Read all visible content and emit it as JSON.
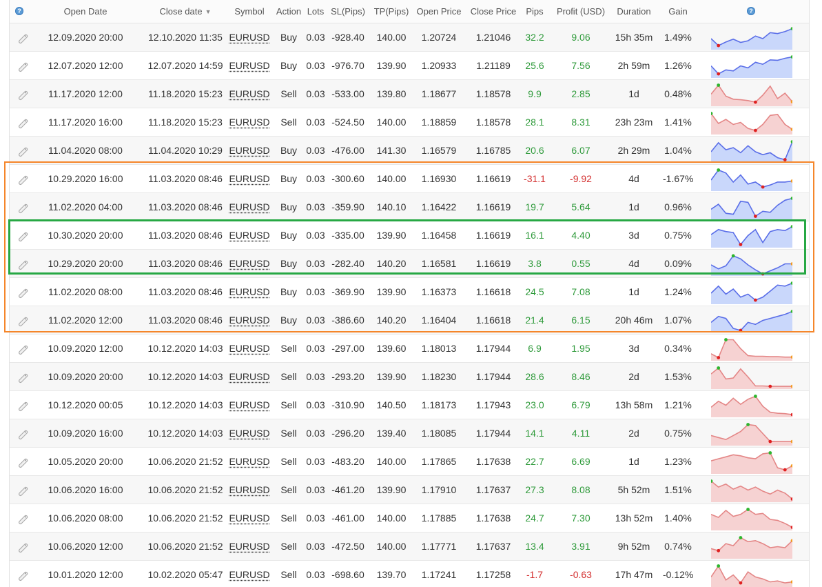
{
  "columns": {
    "open_date": "Open Date",
    "close_date": "Close date",
    "symbol": "Symbol",
    "action": "Action",
    "lots": "Lots",
    "sl": "SL(Pips)",
    "tp": "TP(Pips)",
    "open_price": "Open Price",
    "close_price": "Close Price",
    "pips": "Pips",
    "profit": "Profit (USD)",
    "duration": "Duration",
    "gain": "Gain",
    "help_glyph": "?"
  },
  "colors": {
    "positive": "#2e9a3a",
    "negative": "#d32f2f",
    "buy_line": "#5a6ee8",
    "buy_fill": "#c9d7fb",
    "sell_line": "#e48686",
    "sell_fill": "#f6d2d2",
    "highlight_orange": "#f5862a",
    "highlight_green": "#27a844"
  },
  "trades": [
    {
      "open": "12.09.2020 20:00",
      "close": "12.10.2020 11:35",
      "symbol": "EURUSD",
      "action": "Buy",
      "lots": "0.03",
      "sl": "-928.40",
      "tp": "140.00",
      "open_price": "1.20724",
      "close_price": "1.21046",
      "pips": "32.2",
      "profit": "9.06",
      "duration": "15h 35m",
      "gain": "1.49%",
      "spark": [
        0.55,
        0.9,
        0.72,
        0.58,
        0.74,
        0.66,
        0.42,
        0.55,
        0.25,
        0.3,
        0.2,
        0.05
      ]
    },
    {
      "open": "12.07.2020 12:00",
      "close": "12.07.2020 14:59",
      "symbol": "EURUSD",
      "action": "Buy",
      "lots": "0.03",
      "sl": "-976.70",
      "tp": "139.90",
      "open_price": "1.20933",
      "close_price": "1.21189",
      "pips": "25.6",
      "profit": "7.56",
      "duration": "2h 59m",
      "gain": "1.26%",
      "spark": [
        0.5,
        0.9,
        0.7,
        0.75,
        0.5,
        0.6,
        0.32,
        0.42,
        0.2,
        0.22,
        0.12,
        0.05
      ]
    },
    {
      "open": "11.17.2020 12:00",
      "close": "11.18.2020 15:23",
      "symbol": "EURUSD",
      "action": "Sell",
      "lots": "0.03",
      "sl": "-533.00",
      "tp": "139.80",
      "open_price": "1.18677",
      "close_price": "1.18578",
      "pips": "9.9",
      "profit": "2.85",
      "duration": "1d",
      "gain": "0.48%",
      "spark": [
        0.5,
        0.05,
        0.6,
        0.75,
        0.78,
        0.82,
        0.9,
        0.55,
        0.1,
        0.72,
        0.45,
        0.88
      ]
    },
    {
      "open": "11.17.2020 16:00",
      "close": "11.18.2020 15:23",
      "symbol": "EURUSD",
      "action": "Sell",
      "lots": "0.03",
      "sl": "-524.50",
      "tp": "140.00",
      "open_price": "1.18859",
      "close_price": "1.18578",
      "pips": "28.1",
      "profit": "8.31",
      "duration": "23h 23m",
      "gain": "1.41%",
      "spark": [
        0.05,
        0.55,
        0.35,
        0.6,
        0.5,
        0.8,
        0.9,
        0.6,
        0.15,
        0.1,
        0.6,
        0.85
      ]
    },
    {
      "open": "11.04.2020 08:00",
      "close": "11.04.2020 10:29",
      "symbol": "EURUSD",
      "action": "Buy",
      "lots": "0.03",
      "sl": "-476.00",
      "tp": "141.30",
      "open_price": "1.16579",
      "close_price": "1.16785",
      "pips": "20.6",
      "profit": "6.07",
      "duration": "2h 29m",
      "gain": "1.04%",
      "spark": [
        0.55,
        0.1,
        0.45,
        0.35,
        0.6,
        0.25,
        0.55,
        0.7,
        0.6,
        0.85,
        0.95,
        0.05
      ]
    },
    {
      "open": "10.29.2020 16:00",
      "close": "11.03.2020 08:46",
      "symbol": "EURUSD",
      "action": "Buy",
      "lots": "0.03",
      "sl": "-300.60",
      "tp": "140.00",
      "open_price": "1.16930",
      "close_price": "1.16619",
      "pips": "-31.1",
      "profit": "-9.92",
      "duration": "4d",
      "gain": "-1.67%",
      "spark": [
        0.55,
        0.05,
        0.2,
        0.65,
        0.3,
        0.75,
        0.65,
        0.9,
        0.8,
        0.65,
        0.65,
        0.6
      ]
    },
    {
      "open": "11.02.2020 04:00",
      "close": "11.03.2020 08:46",
      "symbol": "EURUSD",
      "action": "Buy",
      "lots": "0.03",
      "sl": "-359.90",
      "tp": "140.10",
      "open_price": "1.16422",
      "close_price": "1.16619",
      "pips": "19.7",
      "profit": "5.64",
      "duration": "1d",
      "gain": "0.96%",
      "spark": [
        0.6,
        0.35,
        0.8,
        0.85,
        0.2,
        0.25,
        0.95,
        0.7,
        0.75,
        0.4,
        0.15,
        0.05
      ]
    },
    {
      "open": "10.30.2020 20:00",
      "close": "11.03.2020 08:46",
      "symbol": "EURUSD",
      "action": "Buy",
      "lots": "0.03",
      "sl": "-335.00",
      "tp": "139.90",
      "open_price": "1.16458",
      "close_price": "1.16619",
      "pips": "16.1",
      "profit": "4.40",
      "duration": "3d",
      "gain": "0.75%",
      "spark": [
        0.45,
        0.2,
        0.3,
        0.35,
        0.95,
        0.5,
        0.2,
        0.85,
        0.3,
        0.2,
        0.25,
        0.05
      ]
    },
    {
      "open": "10.29.2020 20:00",
      "close": "11.03.2020 08:46",
      "symbol": "EURUSD",
      "action": "Buy",
      "lots": "0.03",
      "sl": "-282.40",
      "tp": "140.20",
      "open_price": "1.16581",
      "close_price": "1.16619",
      "pips": "3.8",
      "profit": "0.55",
      "duration": "4d",
      "gain": "0.09%",
      "spark": [
        0.55,
        0.75,
        0.6,
        0.1,
        0.25,
        0.55,
        0.8,
        1.0,
        0.85,
        0.7,
        0.5,
        0.5
      ]
    },
    {
      "open": "11.02.2020 08:00",
      "close": "11.03.2020 08:46",
      "symbol": "EURUSD",
      "action": "Buy",
      "lots": "0.03",
      "sl": "-369.90",
      "tp": "139.90",
      "open_price": "1.16373",
      "close_price": "1.16618",
      "pips": "24.5",
      "profit": "7.08",
      "duration": "1d",
      "gain": "1.24%",
      "spark": [
        0.55,
        0.2,
        0.6,
        0.35,
        0.75,
        0.6,
        0.9,
        0.75,
        0.45,
        0.15,
        0.2,
        0.05
      ]
    },
    {
      "open": "11.02.2020 12:00",
      "close": "11.03.2020 08:46",
      "symbol": "EURUSD",
      "action": "Buy",
      "lots": "0.03",
      "sl": "-386.60",
      "tp": "140.20",
      "open_price": "1.16404",
      "close_price": "1.16618",
      "pips": "21.4",
      "profit": "6.15",
      "duration": "20h 46m",
      "gain": "1.07%",
      "spark": [
        0.6,
        0.3,
        0.4,
        0.9,
        1.0,
        0.6,
        0.7,
        0.5,
        0.4,
        0.3,
        0.2,
        0.05
      ]
    },
    {
      "open": "10.09.2020 12:00",
      "close": "10.12.2020 14:03",
      "symbol": "EURUSD",
      "action": "Sell",
      "lots": "0.03",
      "sl": "-297.00",
      "tp": "139.60",
      "open_price": "1.18013",
      "close_price": "1.17944",
      "pips": "6.9",
      "profit": "1.95",
      "duration": "3d",
      "gain": "0.34%",
      "spark": [
        0.75,
        0.95,
        0.05,
        0.05,
        0.5,
        0.85,
        0.88,
        0.88,
        0.9,
        0.9,
        0.92,
        0.92
      ]
    },
    {
      "open": "10.09.2020 20:00",
      "close": "10.12.2020 14:03",
      "symbol": "EURUSD",
      "action": "Sell",
      "lots": "0.03",
      "sl": "-293.20",
      "tp": "139.90",
      "open_price": "1.18230",
      "close_price": "1.17944",
      "pips": "28.6",
      "profit": "8.46",
      "duration": "2d",
      "gain": "1.53%",
      "spark": [
        0.35,
        0.05,
        0.6,
        0.55,
        0.1,
        0.5,
        0.95,
        0.95,
        0.97,
        0.97,
        0.97,
        0.97
      ]
    },
    {
      "open": "10.12.2020 00:05",
      "close": "10.12.2020 14:03",
      "symbol": "EURUSD",
      "action": "Sell",
      "lots": "0.03",
      "sl": "-310.90",
      "tp": "140.50",
      "open_price": "1.18173",
      "close_price": "1.17943",
      "pips": "23.0",
      "profit": "6.79",
      "duration": "13h 58m",
      "gain": "1.21%",
      "spark": [
        0.6,
        0.3,
        0.5,
        0.15,
        0.45,
        0.2,
        0.05,
        0.55,
        0.85,
        0.9,
        0.92,
        0.97
      ]
    },
    {
      "open": "10.09.2020 16:00",
      "close": "10.12.2020 14:03",
      "symbol": "EURUSD",
      "action": "Sell",
      "lots": "0.03",
      "sl": "-296.20",
      "tp": "139.40",
      "open_price": "1.18085",
      "close_price": "1.17944",
      "pips": "14.1",
      "profit": "4.11",
      "duration": "2d",
      "gain": "0.75%",
      "spark": [
        0.6,
        0.7,
        0.8,
        0.6,
        0.4,
        0.05,
        0.1,
        0.5,
        0.9,
        0.9,
        0.9,
        0.9
      ]
    },
    {
      "open": "10.05.2020 20:00",
      "close": "10.06.2020 21:52",
      "symbol": "EURUSD",
      "action": "Sell",
      "lots": "0.03",
      "sl": "-483.20",
      "tp": "140.00",
      "open_price": "1.17865",
      "close_price": "1.17638",
      "pips": "22.7",
      "profit": "6.69",
      "duration": "1d",
      "gain": "1.23%",
      "spark": [
        0.45,
        0.35,
        0.25,
        0.15,
        0.2,
        0.3,
        0.35,
        0.1,
        0.05,
        0.8,
        0.9,
        0.7
      ]
    },
    {
      "open": "10.06.2020 16:00",
      "close": "10.06.2020 21:52",
      "symbol": "EURUSD",
      "action": "Sell",
      "lots": "0.03",
      "sl": "-461.20",
      "tp": "139.90",
      "open_price": "1.17910",
      "close_price": "1.17637",
      "pips": "27.3",
      "profit": "8.08",
      "duration": "5h 52m",
      "gain": "1.51%",
      "spark": [
        0.05,
        0.35,
        0.2,
        0.45,
        0.3,
        0.5,
        0.35,
        0.55,
        0.7,
        0.5,
        0.65,
        0.95
      ]
    },
    {
      "open": "10.06.2020 08:00",
      "close": "10.06.2020 21:52",
      "symbol": "EURUSD",
      "action": "Sell",
      "lots": "0.03",
      "sl": "-461.00",
      "tp": "140.00",
      "open_price": "1.17885",
      "close_price": "1.17638",
      "pips": "24.7",
      "profit": "7.30",
      "duration": "13h 52m",
      "gain": "1.40%",
      "spark": [
        0.3,
        0.45,
        0.1,
        0.4,
        0.3,
        0.05,
        0.3,
        0.25,
        0.55,
        0.6,
        0.75,
        0.95
      ]
    },
    {
      "open": "10.06.2020 12:00",
      "close": "10.06.2020 21:52",
      "symbol": "EURUSD",
      "action": "Sell",
      "lots": "0.03",
      "sl": "-472.50",
      "tp": "140.00",
      "open_price": "1.17771",
      "close_price": "1.17637",
      "pips": "13.4",
      "profit": "3.91",
      "duration": "9h 52m",
      "gain": "0.74%",
      "spark": [
        0.6,
        0.7,
        0.35,
        0.45,
        0.05,
        0.25,
        0.2,
        0.35,
        0.55,
        0.5,
        0.55,
        0.2
      ]
    },
    {
      "open": "10.01.2020 12:00",
      "close": "10.02.2020 05:47",
      "symbol": "EURUSD",
      "action": "Sell",
      "lots": "0.03",
      "sl": "-698.60",
      "tp": "139.70",
      "open_price": "1.17241",
      "close_price": "1.17258",
      "pips": "-1.7",
      "profit": "-0.63",
      "duration": "17h 47m",
      "gain": "-0.12%",
      "spark": [
        0.6,
        0.05,
        0.75,
        0.5,
        0.9,
        0.35,
        0.6,
        0.7,
        0.85,
        0.8,
        0.9,
        0.85
      ]
    }
  ]
}
